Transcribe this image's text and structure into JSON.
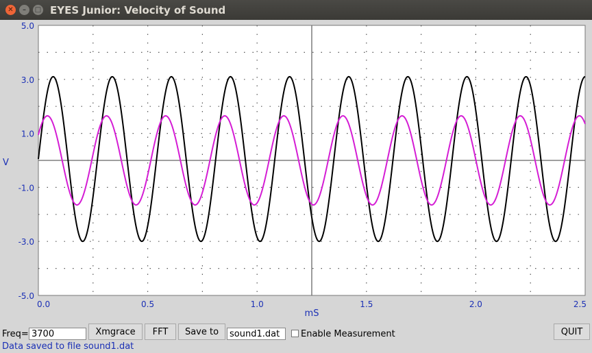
{
  "window": {
    "title": "EYES Junior: Velocity of Sound"
  },
  "chart_data": {
    "type": "line",
    "xlabel": "mS",
    "ylabel": "V",
    "xlim": [
      0,
      2.5
    ],
    "ylim": [
      -5,
      5
    ],
    "xticks": [
      "0.0",
      "0.5",
      "1.0",
      "1.5",
      "2.0",
      "2.5"
    ],
    "yticks": [
      "5.0",
      "3.0",
      "1.0",
      "-1.0",
      "-3.0",
      "-5.0"
    ],
    "grid": "dotted",
    "series": [
      {
        "color": "#000000",
        "amplitude": 3.05,
        "offset": 0.05,
        "frequency_khz": 3.7,
        "phase_deg": 0
      },
      {
        "color": "#d41cd4",
        "amplitude": 1.65,
        "offset": 0.0,
        "frequency_khz": 3.7,
        "phase_deg": 35
      }
    ],
    "colors": {
      "axis_text": "#1a2fb5",
      "background": "#ffffff",
      "grid": "#555555",
      "zero_line": "#666666"
    }
  },
  "controls": {
    "freq_label": "Freq=",
    "freq_value": "3700",
    "xmgrace_label": "Xmgrace",
    "fft_label": "FFT",
    "save_label": "Save to",
    "filename_value": "sound1.dat",
    "measure_label": "Enable Measurement",
    "measure_checked": false,
    "quit_label": "QUIT"
  },
  "status": {
    "message": "Data saved to file sound1.dat"
  }
}
